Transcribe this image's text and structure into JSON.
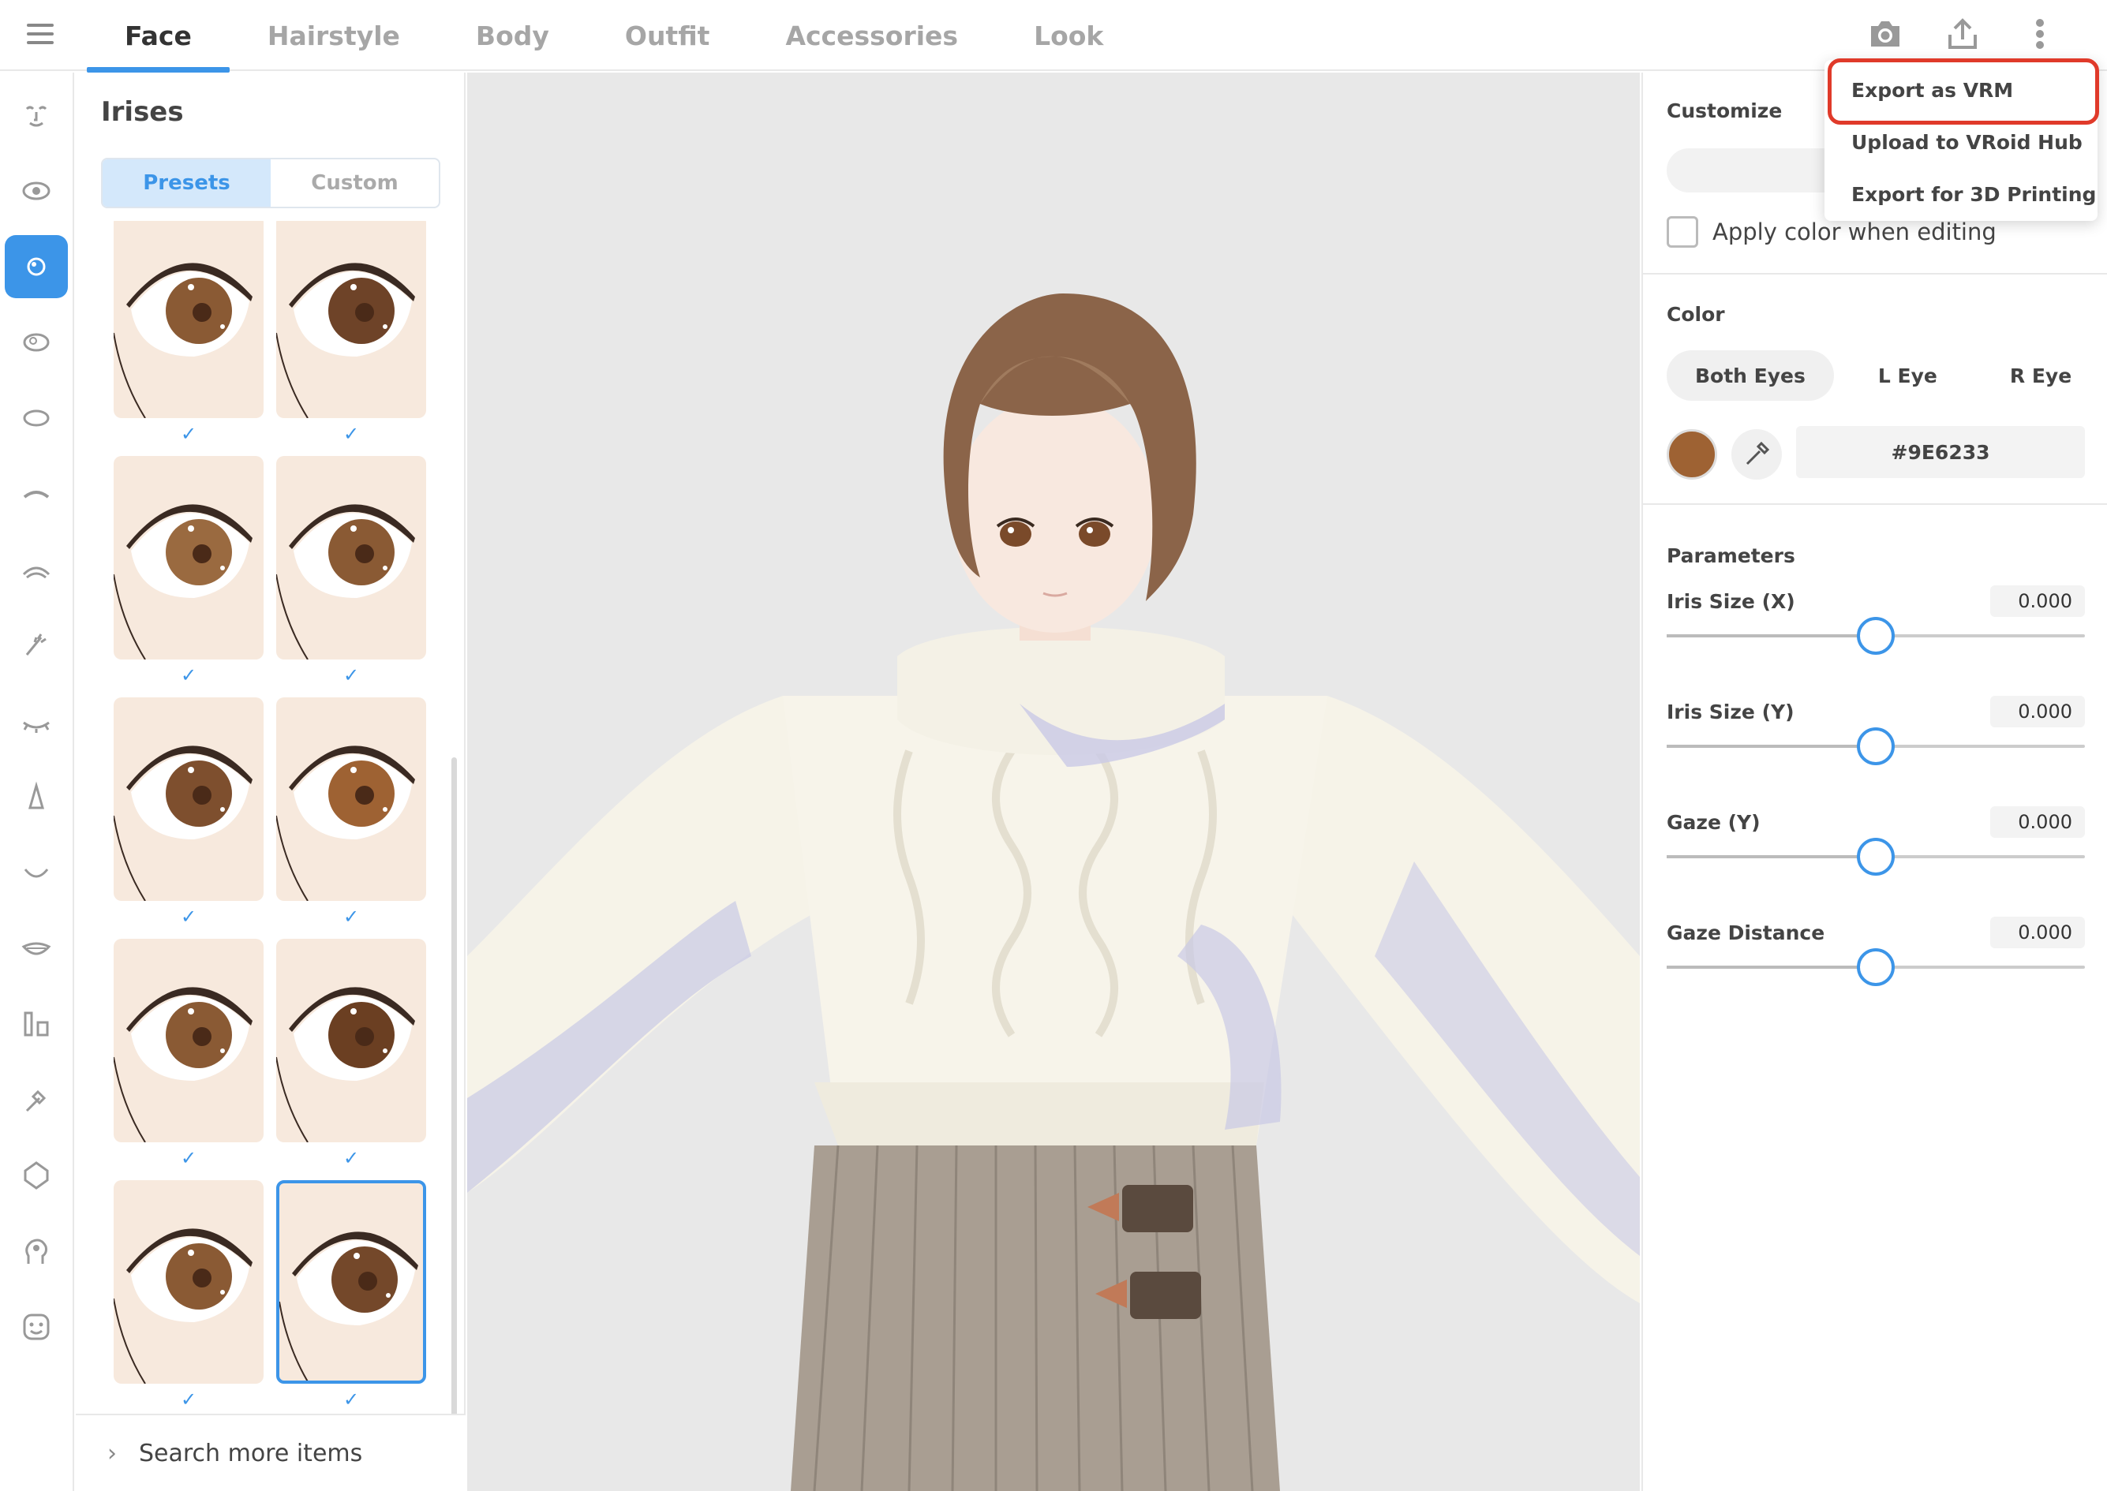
{
  "tabs": [
    {
      "label": "Face",
      "active": true
    },
    {
      "label": "Hairstyle"
    },
    {
      "label": "Body"
    },
    {
      "label": "Outfit"
    },
    {
      "label": "Accessories"
    },
    {
      "label": "Look"
    }
  ],
  "top_actions": [
    "camera-icon",
    "upload-icon",
    "more-vertical-icon"
  ],
  "rail_icons": [
    "face-set-icon",
    "eye-set-icon",
    "iris-icon",
    "eye-white-icon",
    "eye-outline-icon",
    "eyebrow-icon",
    "eyeline-icon",
    "eyelash-icon",
    "eyelid-icon",
    "nose-icon",
    "mouth-icon",
    "teeth-icon",
    "ears-icon",
    "brush-icon",
    "head-shape-icon",
    "head-gear-icon",
    "smiley-icon"
  ],
  "left_panel": {
    "title": "Irises",
    "segment": {
      "presets": "Presets",
      "custom": "Custom",
      "active": "presets"
    },
    "checkmark": "✓",
    "search_more": "Search more items"
  },
  "right_panel": {
    "customize_title": "Customize",
    "apply_color_label": "Apply color when editing",
    "color_title": "Color",
    "eye_tabs": [
      "Both Eyes",
      "L Eye",
      "R Eye"
    ],
    "color_hex": "#9E6233",
    "params_title": "Parameters",
    "params": [
      {
        "label": "Iris Size (X)",
        "value": "0.000",
        "fraction": 0.5
      },
      {
        "label": "Iris Size (Y)",
        "value": "0.000",
        "fraction": 0.5
      },
      {
        "label": "Gaze (Y)",
        "value": "0.000",
        "fraction": 0.5
      },
      {
        "label": "Gaze Distance",
        "value": "0.000",
        "fraction": 0.5
      }
    ]
  },
  "menu": {
    "items": [
      "Export as VRM",
      "Upload to VRoid Hub",
      "Export for 3D Printing"
    ],
    "highlighted": "Export as VRM"
  },
  "colors": {
    "accent": "#3c95e8",
    "highlight": "#e03a2a",
    "iris": "#9E6233"
  }
}
